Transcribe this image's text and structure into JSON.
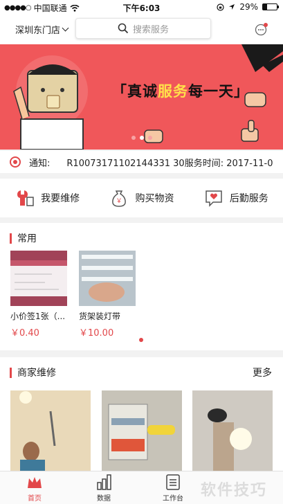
{
  "status_bar": {
    "carrier": "中国联通",
    "time": "下午6:03",
    "battery": "29%"
  },
  "header": {
    "city": "深圳东门店",
    "search_placeholder": "搜索服务"
  },
  "banner": {
    "text_part1": "真诚",
    "text_highlight": "服务",
    "text_part2": "每一天",
    "bracket_left": "「",
    "bracket_right": "」",
    "slides": 3,
    "active_slide": 2
  },
  "notice": {
    "label": "通知:",
    "text": "R10073171102144331 30服务时间: 2017-11-0"
  },
  "services": [
    {
      "label": "我要维修",
      "icon": "repair-icon"
    },
    {
      "label": "购买物资",
      "icon": "money-bag-icon"
    },
    {
      "label": "后勤服务",
      "icon": "heart-chat-icon"
    }
  ],
  "common": {
    "title": "常用",
    "items": [
      {
        "name": "小价签1张（...",
        "price": "￥0.40"
      },
      {
        "name": "货架装灯带",
        "price": "￥10.00"
      }
    ]
  },
  "repair": {
    "title": "商家维修",
    "more": "更多"
  },
  "tabbar": {
    "items": [
      "首页",
      "数据",
      "工作台"
    ],
    "active": "首页"
  },
  "watermark": "软件技巧",
  "colors": {
    "accent": "#e2474a",
    "banner_bg": "#f0575a"
  }
}
